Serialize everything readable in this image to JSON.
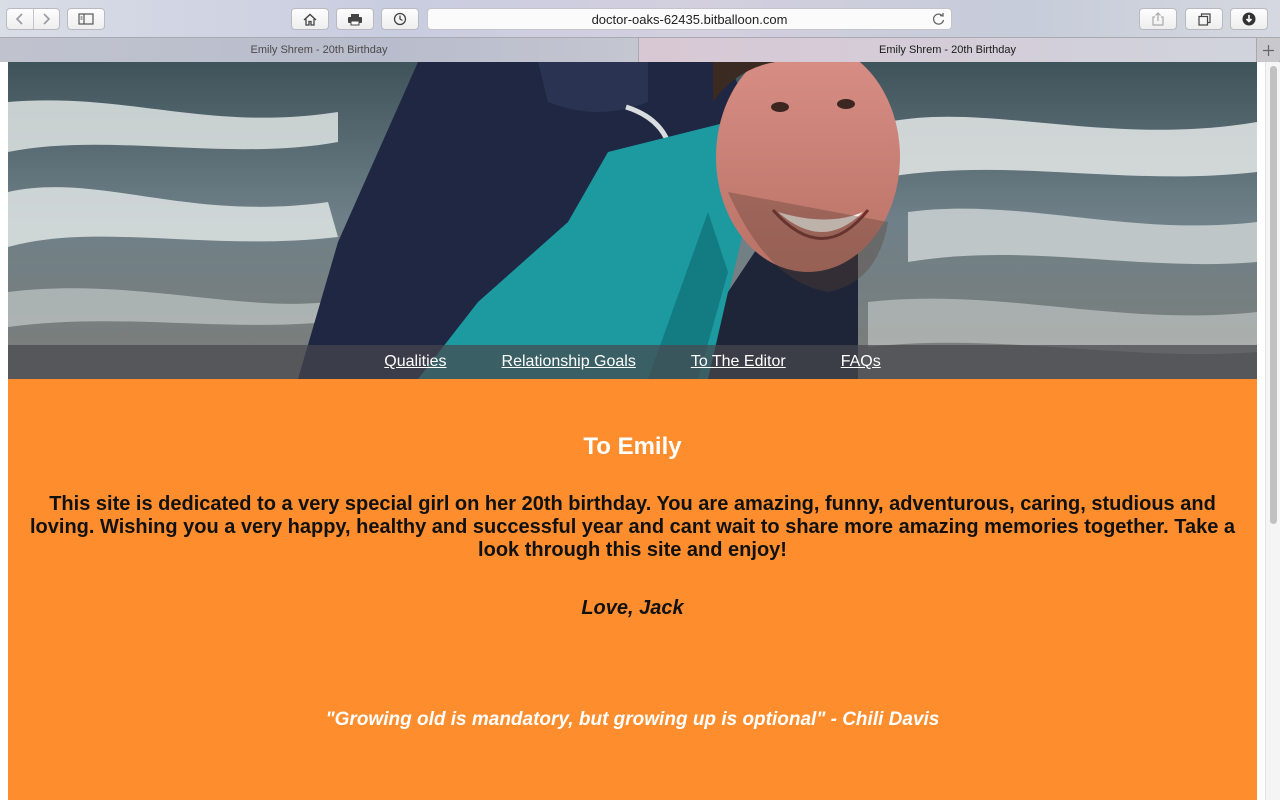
{
  "browser": {
    "url": "doctor-oaks-62435.bitballoon.com",
    "tabs": [
      {
        "title": "Emily Shrem - 20th Birthday",
        "active": false
      },
      {
        "title": "Emily Shrem - 20th Birthday",
        "active": true
      }
    ],
    "icons": [
      "back-icon",
      "forward-icon",
      "sidebar-icon",
      "home-icon",
      "print-icon",
      "history-icon",
      "reload-icon",
      "share-icon",
      "tabs-overview-icon",
      "downloads-icon",
      "new-tab-icon"
    ]
  },
  "page": {
    "nav": {
      "items": [
        "Qualities",
        "Relationship Goals",
        "To The Editor",
        "FAQs"
      ]
    },
    "heading": "To Emily",
    "message": "This site is dedicated to a very special girl on her 20th birthday. You are amazing, funny, adventurous, caring, studious and loving. Wishing you a very happy, healthy and successful year and cant wait to share more amazing memories together. Take a look through this site and enjoy!",
    "signoff": "Love, Jack",
    "quote": "\"Growing old is mandatory, but growing up is optional\" - Chili Davis"
  },
  "colors": {
    "page_background": "#fe8d2e",
    "heading_text": "#ffffff",
    "body_text": "#111111",
    "nav_overlay": "#46484e"
  }
}
